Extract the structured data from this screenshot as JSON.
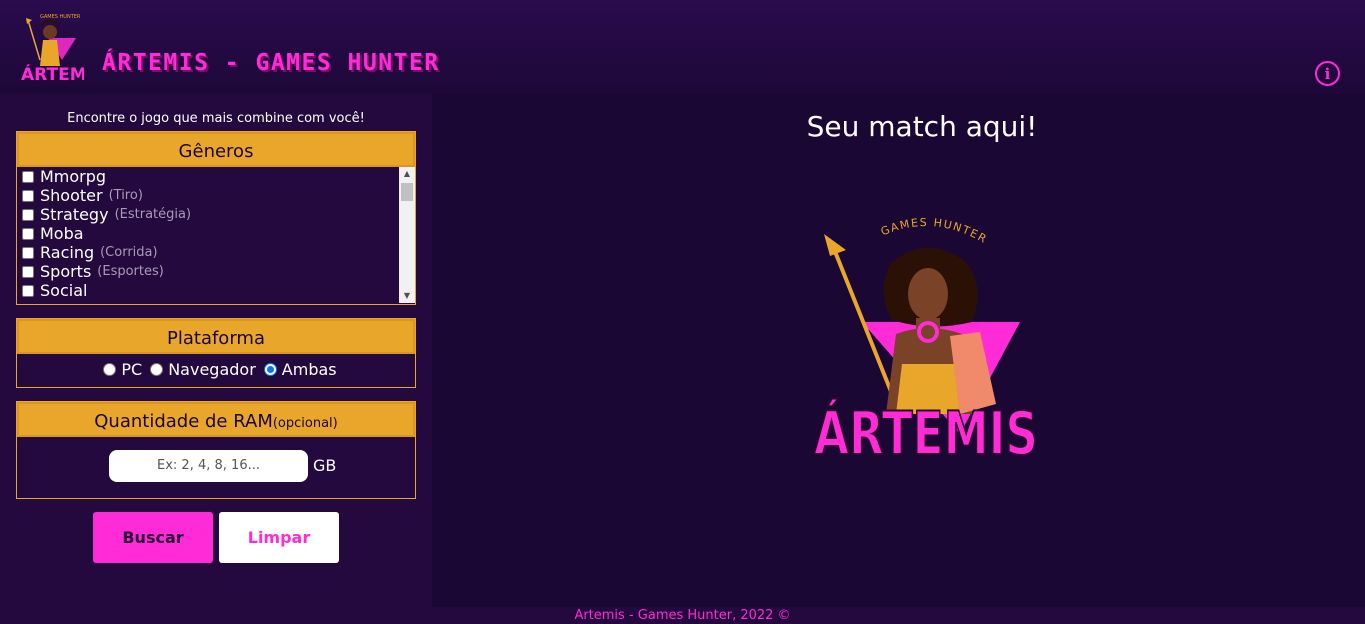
{
  "header": {
    "logo_text": "ÁRTEMIS",
    "logo_subtitle": "GAMES HUNTER",
    "title": "ÁRTEMIS - GAMES HUNTER",
    "info_icon": "i"
  },
  "sidebar": {
    "intro": "Encontre o jogo que mais combine com você!",
    "genres": {
      "title": "Gêneros",
      "items": [
        {
          "label": "Mmorpg",
          "sub": ""
        },
        {
          "label": "Shooter",
          "sub": "(Tiro)"
        },
        {
          "label": "Strategy",
          "sub": "(Estratégia)"
        },
        {
          "label": "Moba",
          "sub": ""
        },
        {
          "label": "Racing",
          "sub": "(Corrida)"
        },
        {
          "label": "Sports",
          "sub": "(Esportes)"
        },
        {
          "label": "Social",
          "sub": ""
        }
      ]
    },
    "platform": {
      "title": "Plataforma",
      "options": [
        "PC",
        "Navegador",
        "Ambas"
      ],
      "selected": "Ambas"
    },
    "ram": {
      "title": "Quantidade de RAM",
      "optional": "(opcional)",
      "placeholder": "Ex: 2, 4, 8, 16...",
      "unit": "GB"
    },
    "buttons": {
      "search": "Buscar",
      "clear": "Limpar"
    }
  },
  "main": {
    "title": "Seu match aqui!",
    "logo_text": "ÁRTEMIS",
    "logo_subtitle": "GAMES HUNTER"
  },
  "footer": {
    "text": "Artemis - Games Hunter, 2022 ©"
  },
  "colors": {
    "accent": "#ff2bd6",
    "gold": "#e8a72a",
    "background": "#1d0838"
  }
}
